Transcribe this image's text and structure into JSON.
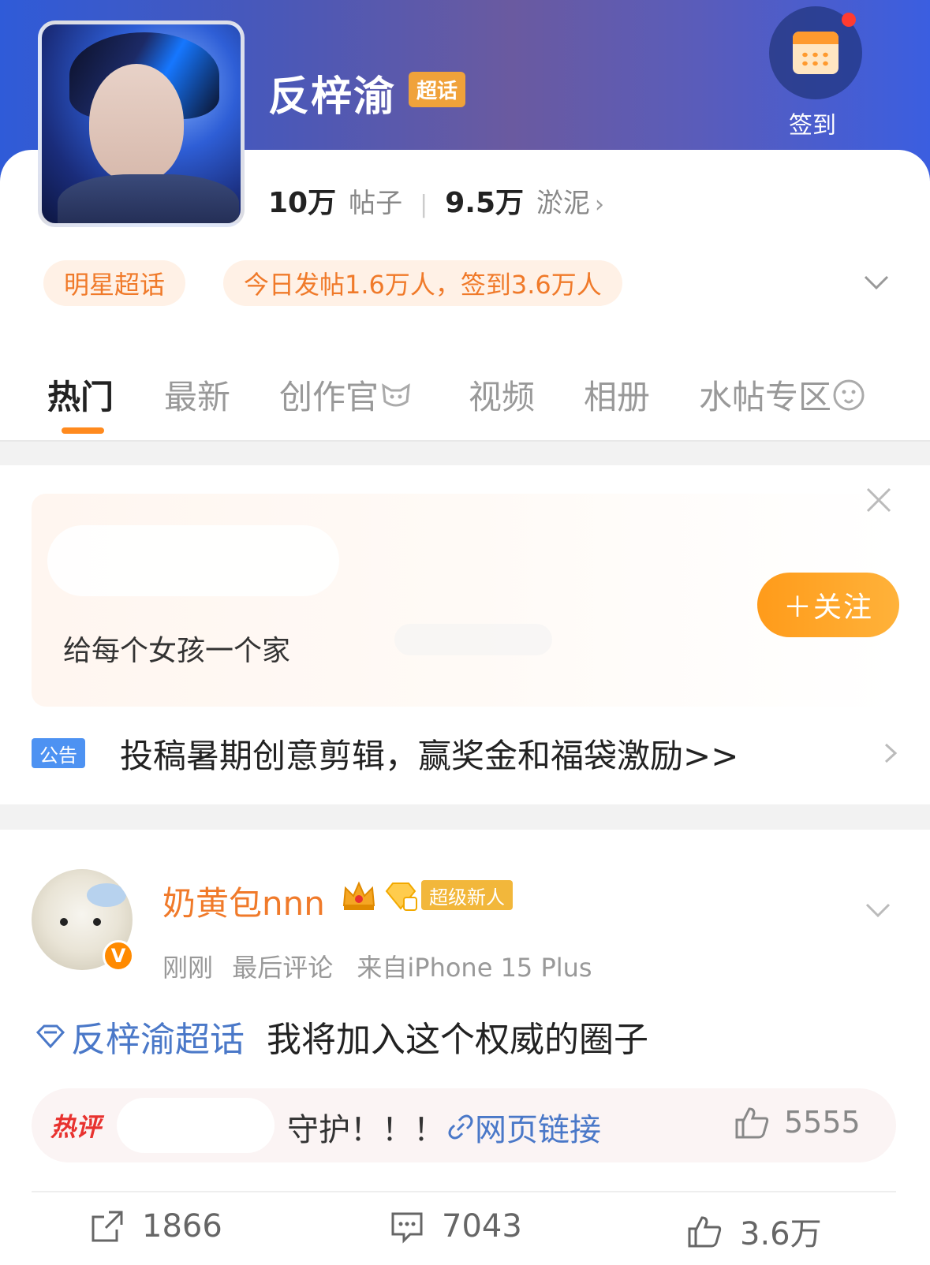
{
  "header": {
    "title": "反梓渝",
    "title_badge": "超话",
    "checkin_label": "签到",
    "stats": {
      "posts_count": "10万",
      "posts_label": "帖子",
      "members_count": "9.5万",
      "members_label": "淤泥"
    },
    "tags": {
      "category": "明星超话",
      "today": "今日发帖1.6万人，签到3.6万人"
    }
  },
  "tabs": [
    {
      "label": "热门",
      "active": true
    },
    {
      "label": "最新"
    },
    {
      "label": "创作官"
    },
    {
      "label": "视频"
    },
    {
      "label": "相册"
    },
    {
      "label": "水帖专区"
    }
  ],
  "promo": {
    "text": "给每个女孩一个家",
    "follow_label": "＋关注"
  },
  "notice": {
    "tag": "公告",
    "text": "投稿暑期创意剪辑，赢奖金和福袋激励>>"
  },
  "post": {
    "author": "奶黄包nnn",
    "author_badge": "超级新人",
    "verified_mark": "V",
    "time": "刚刚",
    "meta_action": "最后评论",
    "source": "来自iPhone 15 Plus",
    "topic": "反梓渝超话",
    "content": "我将加入这个权威的圈子",
    "hot_comment": {
      "tag": "热评",
      "text": "守护！！！",
      "link_label": "网页链接",
      "likes": "5555"
    },
    "actions": {
      "reposts": "1866",
      "comments": "7043",
      "likes": "3.6万"
    }
  },
  "colors": {
    "accent_orange": "#f07a2a",
    "link_blue": "#4a78c8",
    "hot_red": "#e8322f",
    "notice_blue": "#4d92f2"
  }
}
